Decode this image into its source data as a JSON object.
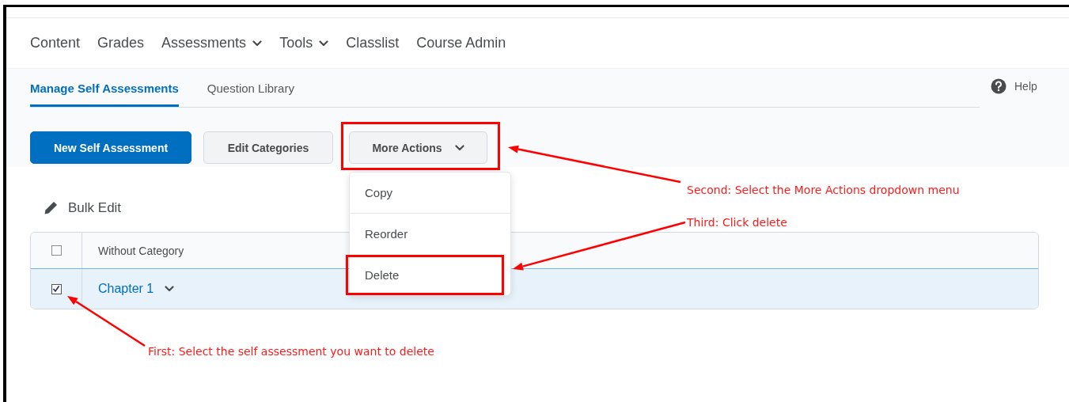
{
  "nav": {
    "items": [
      {
        "label": "Content",
        "has_menu": false
      },
      {
        "label": "Grades",
        "has_menu": false
      },
      {
        "label": "Assessments",
        "has_menu": true
      },
      {
        "label": "Tools",
        "has_menu": true
      },
      {
        "label": "Classlist",
        "has_menu": false
      },
      {
        "label": "Course Admin",
        "has_menu": false
      }
    ]
  },
  "tabs": [
    {
      "label": "Manage Self Assessments",
      "selected": true
    },
    {
      "label": "Question Library",
      "selected": false
    }
  ],
  "help": {
    "label": "Help"
  },
  "buttons": [
    {
      "label": "New Self Assessment",
      "kind": "primary"
    },
    {
      "label": "Edit Categories",
      "kind": "secondary"
    },
    {
      "label": "More Actions",
      "kind": "dropdown"
    }
  ],
  "menu": {
    "items": [
      {
        "label": "Copy",
        "highlighted": false
      },
      {
        "label": "Reorder",
        "highlighted": false
      },
      {
        "label": "Delete",
        "highlighted": true
      }
    ]
  },
  "bulk_edit": {
    "label": "Bulk Edit"
  },
  "table": {
    "header": {
      "label": "Without Category",
      "checked": false
    },
    "rows": [
      {
        "label": "Chapter 1",
        "checked": true,
        "selected": true
      }
    ]
  },
  "annotations": [
    {
      "text": "Second: Select the More Actions dropdown menu"
    },
    {
      "text": "Third: Click delete"
    },
    {
      "text": "First: Select the self assessment you want to delete"
    }
  ]
}
